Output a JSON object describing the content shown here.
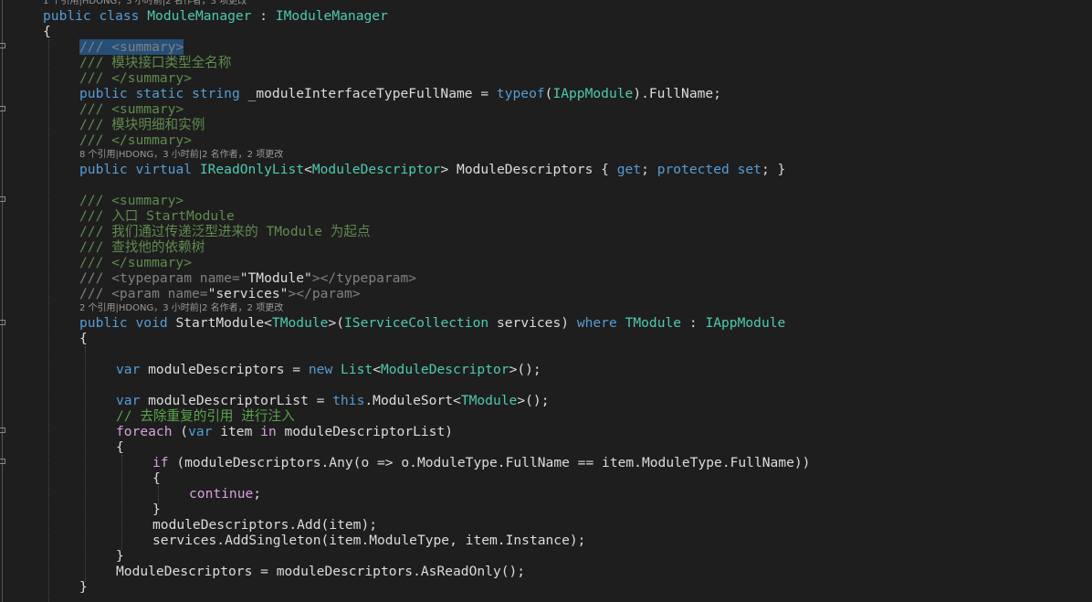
{
  "editor": {
    "codelens_top": "1 个引用|HDONG，3 小时前|2 名作者，3 项更改",
    "codelens_descriptors": "8 个引用|HDONG，3 小时前|2 名作者，2 项更改",
    "codelens_startmodule": "2 个引用|HDONG，3 小时前|2 名作者，2 项更改",
    "lines": {
      "l01_public": "public",
      "l01_class": "class",
      "l01_name": "ModuleManager",
      "l01_colon": " : ",
      "l01_iface": "IModuleManager",
      "l02": "{",
      "l03_slashes": "///",
      "l03_tag": "<summary>",
      "l04": "/// 模块接口类型全名称",
      "l05": "/// </summary>",
      "l06_public": "public",
      "l06_static": "static",
      "l06_string": "string",
      "l06_field": "_moduleInterfaceTypeFullName",
      "l06_eq": " = ",
      "l06_typeof": "typeof",
      "l06_lp": "(",
      "l06_type": "IAppModule",
      "l06_rest": ").FullName;",
      "l07": "/// <summary>",
      "l08": "/// 模块明细和实例",
      "l09": "/// </summary>",
      "l10_public": "public",
      "l10_virtual": "virtual",
      "l10_type": "IReadOnlyList",
      "l10_lt": "<",
      "l10_arg": "ModuleDescriptor",
      "l10_gt": ">",
      "l10_name": " ModuleDescriptors { ",
      "l10_get": "get",
      "l10_semi": "; ",
      "l10_protected": "protected",
      "l10_set": "set",
      "l10_end": "; }",
      "l11": "/// <summary>",
      "l12": "/// 入口 StartModule",
      "l13": "/// 我们通过传递泛型进来的 TModule 为起点",
      "l14": "/// 查找他的依赖树",
      "l15": "/// </summary>",
      "l16_a": "/// <typeparam name=",
      "l16_b": "\"TModule\"",
      "l16_c": "></typeparam>",
      "l17_a": "/// <param name=",
      "l17_b": "\"services\"",
      "l17_c": "></param>",
      "l18_public": "public",
      "l18_void": "void",
      "l18_name": "StartModule",
      "l18_lt": "<",
      "l18_tp": "TModule",
      "l18_gt": ">(",
      "l18_ptype": "IServiceCollection",
      "l18_pname": " services) ",
      "l18_where": "where",
      "l18_tp2": "TModule",
      "l18_colon": " : ",
      "l18_iface": "IAppModule",
      "l19": "{",
      "l20_var": "var",
      "l20_name": " moduleDescriptors = ",
      "l20_new": "new",
      "l20_list": "List",
      "l20_lt": "<",
      "l20_arg": "ModuleDescriptor",
      "l20_end": ">();",
      "l21_var": "var",
      "l21_name": " moduleDescriptorList = ",
      "l21_this": "this",
      "l21_call": ".ModuleSort<",
      "l21_tp": "TModule",
      "l21_end": ">();",
      "l22": "// 去除重复的引用 进行注入",
      "l23_foreach": "foreach",
      "l23_lp": " (",
      "l23_var": "var",
      "l23_item": " item ",
      "l23_in": "in",
      "l23_rest": " moduleDescriptorList)",
      "l24": "{",
      "l25_if": "if",
      "l25_rest": " (moduleDescriptors.Any(o => o.ModuleType.FullName == item.ModuleType.FullName))",
      "l26": "{",
      "l27": "continue",
      "l27_semi": ";",
      "l28": "}",
      "l29": "moduleDescriptors.Add(item);",
      "l30": "services.AddSingleton(item.ModuleType, item.Instance);",
      "l31": "}",
      "l32": "ModuleDescriptors = moduleDescriptors.AsReadOnly();",
      "l33": "}"
    }
  }
}
